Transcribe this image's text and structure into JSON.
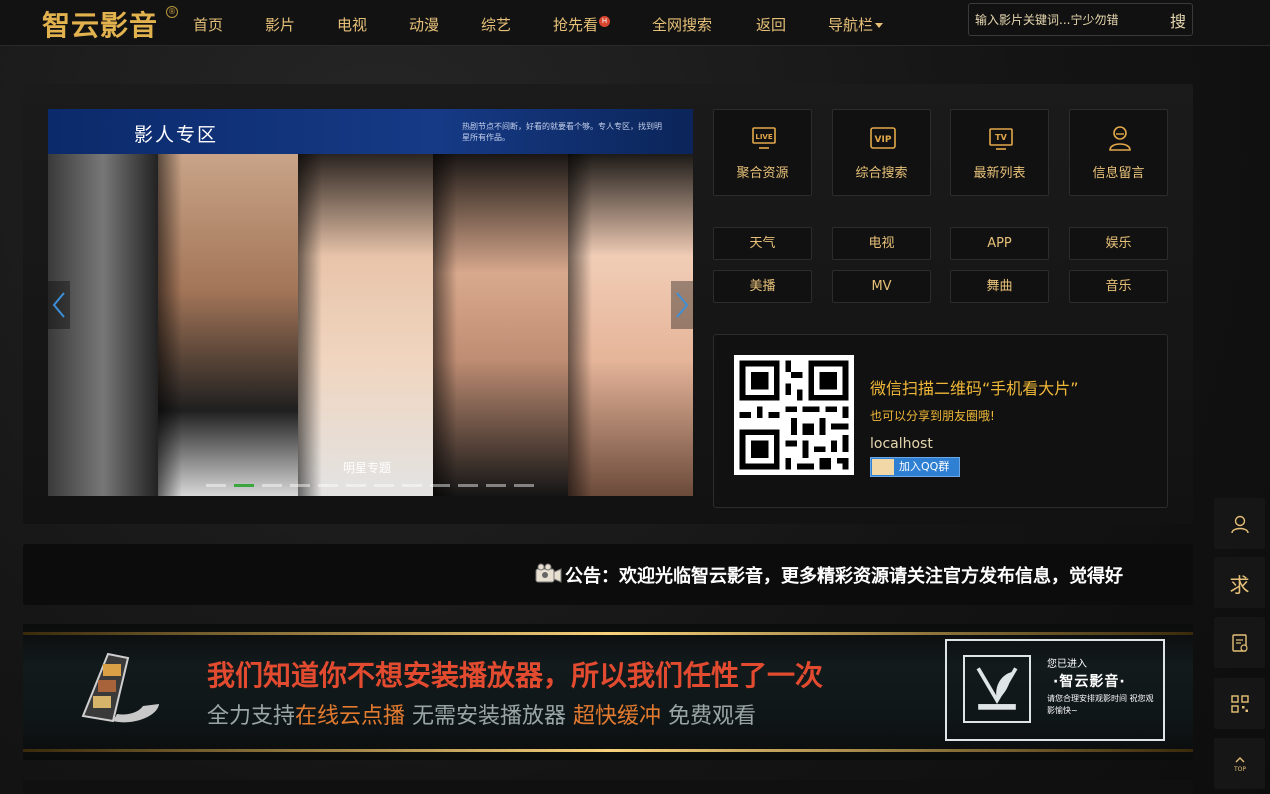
{
  "header": {
    "logo": "智云影音",
    "nav": [
      {
        "label": "首页"
      },
      {
        "label": "影片"
      },
      {
        "label": "电视"
      },
      {
        "label": "动漫"
      },
      {
        "label": "综艺"
      },
      {
        "label": "抢先看",
        "badge": "H"
      },
      {
        "label": "全网搜索"
      },
      {
        "label": "返回"
      },
      {
        "label": "导航栏"
      }
    ],
    "search": {
      "placeholder": "输入影片关键词...宁少勿错",
      "button": "搜"
    }
  },
  "carousel": {
    "title": "影人专区",
    "subtitle": "热剧节点不间断，好看的就要看个够。专人专区，找到明星所有作品。",
    "caption": "明星专题",
    "slide_count": 12,
    "active_index": 1
  },
  "tiles": [
    {
      "label": "聚合资源",
      "icon": "live-tv-icon"
    },
    {
      "label": "综合搜索",
      "icon": "vip-icon"
    },
    {
      "label": "最新列表",
      "icon": "tv-icon"
    },
    {
      "label": "信息留言",
      "icon": "user-icon"
    }
  ],
  "chips": [
    "天气",
    "电视",
    "APP",
    "娱乐",
    "美播",
    "MV",
    "舞曲",
    "音乐"
  ],
  "qr": {
    "title": "微信扫描二维码“手机看大片”",
    "subtitle": "也可以分享到朋友圈哦!",
    "host": "localhost",
    "qq_button": "加入QQ群"
  },
  "notice": {
    "text": "公告：欢迎光临智云影音，更多精彩资源请关注官方发布信息，觉得好"
  },
  "banner": {
    "line1": "我们知道你不想安装播放器，所以我们任性了一次",
    "line2_parts": [
      "全力支持",
      "在线云点播",
      " 无需安装播放器 ",
      "超快缓冲",
      " 免费观看"
    ],
    "box_line1": "您已进入",
    "box_line2": "·智云影音·",
    "box_line3": "请您合理安排观影时间 祝您观影愉快~"
  },
  "side_toolbar": [
    {
      "icon": "user-icon"
    },
    {
      "label": "求"
    },
    {
      "icon": "document-icon"
    },
    {
      "icon": "qrcode-icon"
    },
    {
      "icon": "back-to-top-icon",
      "label": "TOP"
    }
  ],
  "colors": {
    "accent": "#e6c078",
    "brand": "#e2b24e",
    "qr_text": "#f0b838",
    "qq_blue": "#2f7fd3"
  }
}
